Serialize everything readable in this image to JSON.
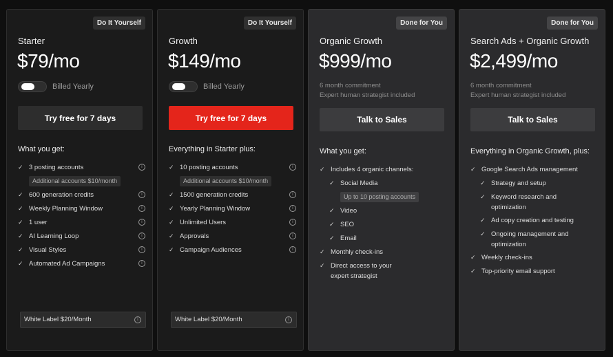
{
  "plans": [
    {
      "badge": "Do It Yourself",
      "name": "Starter",
      "price": "$79/mo",
      "billed_label": "Billed Yearly",
      "cta": "Try free for 7 days",
      "section_title": "What you get:",
      "features": [
        "3 posting accounts",
        "600 generation credits",
        "Weekly Planning Window",
        "1 user",
        "AI Learning Loop",
        "Visual Styles",
        "Automated Ad Campaigns"
      ],
      "accounts_note": "Additional accounts $10/month",
      "addon": "White Label $20/Month",
      "info_icon": "info-icon",
      "check_icon": "check-icon"
    },
    {
      "badge": "Do It Yourself",
      "name": "Growth",
      "price": "$149/mo",
      "billed_label": "Billed Yearly",
      "cta": "Try free for 7 days",
      "section_title": "Everything in Starter plus:",
      "features": [
        "10 posting accounts",
        "1500 generation credits",
        "Yearly Planning Window",
        "Unlimited Users",
        "Approvals",
        "Campaign Audiences"
      ],
      "accounts_note": "Additional accounts $10/month",
      "addon": "White Label $20/Month"
    },
    {
      "badge": "Done for You",
      "name": "Organic Growth",
      "price": "$999/mo",
      "commitment": "6 month commitment",
      "strategist": "Expert human strategist included",
      "cta": "Talk to Sales",
      "section_title": "What you get:",
      "lead_feature": "Includes 4 organic channels:",
      "channels": [
        "Social Media",
        "Video",
        "SEO",
        "Email"
      ],
      "channel_note": "Up to 10 posting accounts",
      "more_features": [
        "Monthly check-ins",
        "Direct access to your expert strategist"
      ]
    },
    {
      "badge": "Done for You",
      "name": "Search Ads + Organic Growth",
      "price": "$2,499/mo",
      "commitment": "6 month commitment",
      "strategist": "Expert human strategist included",
      "cta": "Talk to Sales",
      "section_title": "Everything in Organic Growth, plus:",
      "lead_feature": "Google Search Ads management",
      "sub_features": [
        "Strategy and setup",
        "Keyword research and optimization",
        "Ad copy creation and testing",
        "Ongoing management and optimization"
      ],
      "more_features": [
        "Weekly check-ins",
        "Top-priority email support"
      ]
    }
  ],
  "colors": {
    "accent_red": "#e4251b",
    "background": "#0f0f0f"
  }
}
